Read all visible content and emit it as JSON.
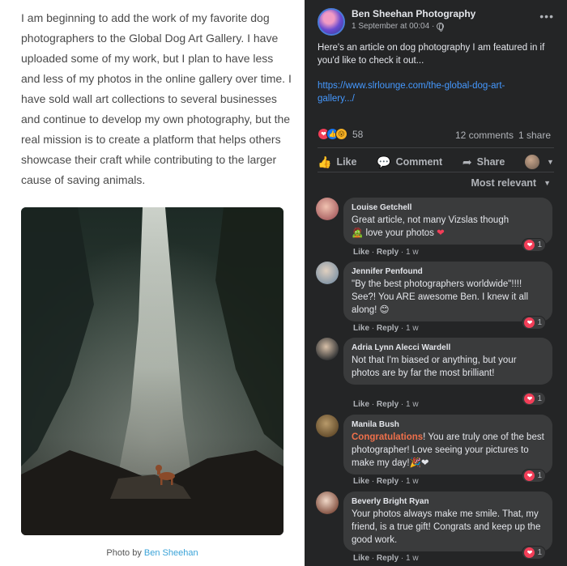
{
  "article": {
    "text": "I am beginning to add the work of my favorite dog photographers to the Global Dog Art Gallery. I have uploaded some of my work, but I plan to have less and less of my photos in the online gallery over time. I have sold wall art collections to several businesses and continue to develop my own photography, but the real mission is to create a platform that helps others showcase their craft while contributing to the larger cause of saving animals.",
    "caption_prefix": "Photo by",
    "caption_link": "Ben Sheehan"
  },
  "post": {
    "page_name": "Ben Sheehan Photography",
    "date": "1 September at 00:04 ·",
    "more_icon": "ellipsis-icon",
    "text": "Here's an article on dog photography I am featured in if you'd like to check it out...",
    "link": "https://www.slrlounge.com/the-global-dog-art-gallery.../",
    "reaction_count": "58",
    "comments_count": "12 comments",
    "shares_count": "1 share",
    "actions": {
      "like": "Like",
      "comment": "Comment",
      "share": "Share"
    },
    "sort_label": "Most relevant"
  },
  "comments": [
    {
      "name": "Louise Getchell",
      "text": "Great article, not many Vizslas though",
      "text2": "love your photos",
      "emoji1": "🧟",
      "emoji2": "❤",
      "reacts": "1",
      "like": "Like",
      "reply": "Reply",
      "time": "1 w"
    },
    {
      "name": "Jennifer Penfound",
      "text": "\"By the best photographers worldwide\"!!!! See?! You ARE awesome Ben. I knew it all along!",
      "emoji2": "😊",
      "reacts": "1",
      "like": "Like",
      "reply": "Reply",
      "time": "1 w"
    },
    {
      "name": "Adria Lynn Alecci Wardell",
      "text": "Not that I'm biased or anything, but your photos are by far the most brilliant!",
      "reacts": "1",
      "like": "Like",
      "reply": "Reply",
      "time": "1 w"
    },
    {
      "name": "Manila Bush",
      "highlight": "Congratulations",
      "text": "! You are truly one of the best photographer! Love seeing your pictures to make my day!",
      "emoji2": "🎉❤",
      "reacts": "1",
      "like": "Like",
      "reply": "Reply",
      "time": "1 w"
    },
    {
      "name": "Beverly Bright Ryan",
      "text": "Your photos always make me smile. That, my friend, is a true gift! Congrats and keep up the good work.",
      "reacts": "1",
      "like": "Like",
      "reply": "Reply",
      "time": "1 w"
    }
  ],
  "colors": {
    "fb_bg": "#242526",
    "bubble": "#3a3b3c",
    "link": "#4599ff",
    "love": "#f33e58",
    "caption_link": "#3aa3d8"
  }
}
